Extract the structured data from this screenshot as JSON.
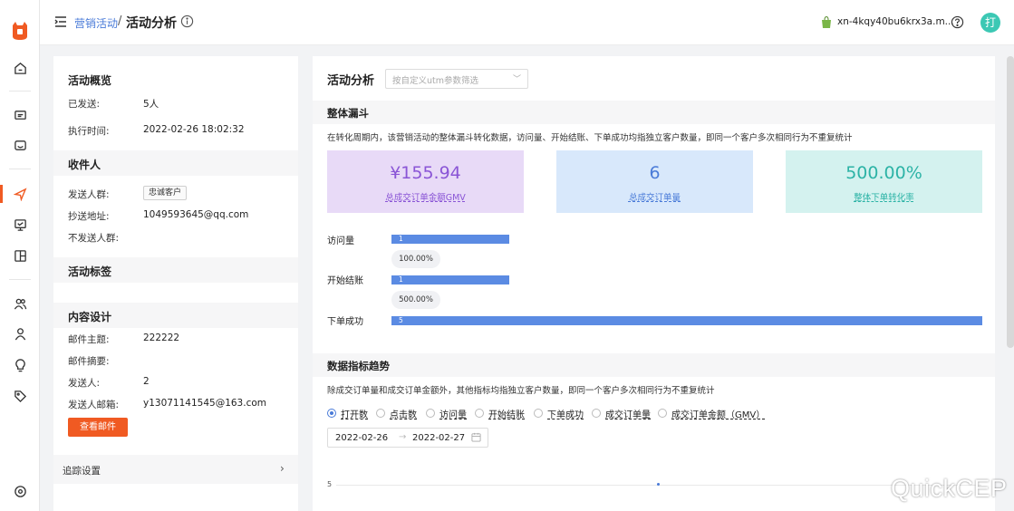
{
  "rail": {
    "icons": [
      "logo-icon",
      "home-icon",
      "message-icon",
      "inbox-icon",
      "send-icon",
      "monitor-icon",
      "layout-icon",
      "users-icon",
      "user-icon",
      "bulb-icon",
      "tag-icon",
      "settings-icon"
    ]
  },
  "header": {
    "breadcrumb_parent": "营销活动",
    "breadcrumb_sep": "/",
    "breadcrumb_current": "活动分析",
    "shop_name": "xn-4kqy40bu6krx3a.m...",
    "avatar_text": "打"
  },
  "overview": {
    "title": "活动概览",
    "sent_label": "已发送:",
    "sent_value": "5人",
    "exec_time_label": "执行时间:",
    "exec_time_value": "2022-02-26 18:02:32"
  },
  "recipients": {
    "title": "收件人",
    "target_group_label": "发送人群:",
    "target_group_tag": "忠诚客户",
    "cc_label": "抄送地址:",
    "cc_value": "1049593645@qq.com",
    "exclude_label": "不发送人群:"
  },
  "activity_tags": {
    "title": "活动标签"
  },
  "content": {
    "title": "内容设计",
    "subject_label": "邮件主题:",
    "subject_value": "222222",
    "summary_label": "邮件摘要:",
    "sender_label": "发送人:",
    "sender_value": "2",
    "sender_email_label": "发送人邮箱:",
    "sender_email_value": "y13071141545@163.com",
    "view_button": "查看邮件"
  },
  "tracking": {
    "label": "追踪设置",
    "chevron": "›"
  },
  "analysis": {
    "title": "活动分析",
    "utm_placeholder": "按自定义utm参数筛选",
    "funnel_title": "整体漏斗",
    "funnel_desc": "在转化周期内，该营销活动的整体漏斗转化数据，访问量、开始结账、下单成功均指独立客户数量，即同一个客户多次相同行为不重复统计",
    "cards": [
      {
        "value": "¥155.94",
        "label": "总成交订单金额GMV",
        "bg": "#e8daf7",
        "color": "#8a55d6"
      },
      {
        "value": "6",
        "label": "总成交订单量",
        "bg": "#d8e8fb",
        "color": "#4a7bd8"
      },
      {
        "value": "500.00%",
        "label": "整体下单转化率",
        "bg": "#d4f2ef",
        "color": "#2cb3a6"
      }
    ],
    "funnel": [
      {
        "label": "访问量",
        "value": "1",
        "fraction": 0.2
      },
      {
        "label": "开始结账",
        "value": "1",
        "fraction": 0.2
      },
      {
        "label": "下单成功",
        "value": "5",
        "fraction": 1.0
      }
    ],
    "conversion_pcts": [
      "100.00%",
      "500.00%"
    ],
    "trend_title": "数据指标趋势",
    "trend_desc": "除成交订单量和成交订单金额外，其他指标均指独立客户数量，即同一个客户多次相同行为不重复统计",
    "metrics": [
      "打开数",
      "点击数",
      "访问量",
      "开始结账",
      "下单成功",
      "成交订单量",
      "成交订单金额（GMV）"
    ],
    "selected_metric": "打开数",
    "date_start": "2022-02-26",
    "date_arrow": "→",
    "date_end": "2022-02-27",
    "y_tick": "5"
  },
  "watermark": "QuickCEP"
}
